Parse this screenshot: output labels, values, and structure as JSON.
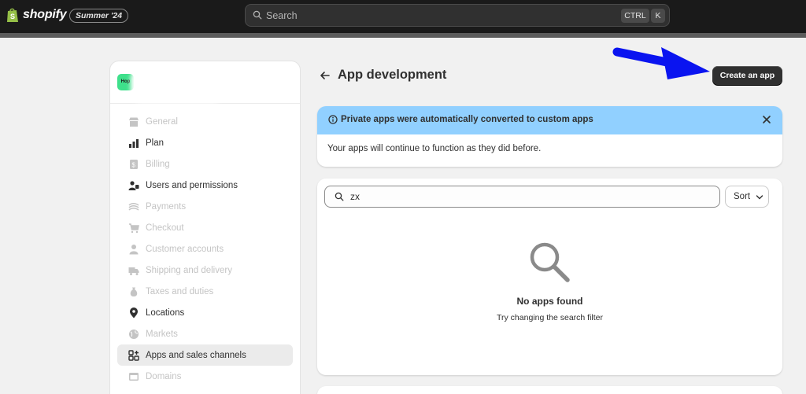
{
  "topbar": {
    "logo_text": "shopify",
    "edition_badge": "Summer '24",
    "search_placeholder": "Search",
    "shortcut_ctrl": "CTRL",
    "shortcut_k": "K"
  },
  "sidebar": {
    "store_avatar_text": "Hop",
    "items": [
      {
        "label": "General",
        "icon": "store-icon",
        "enabled": false
      },
      {
        "label": "Plan",
        "icon": "plan-chart-icon",
        "enabled": true
      },
      {
        "label": "Billing",
        "icon": "billing-icon",
        "enabled": false
      },
      {
        "label": "Users and permissions",
        "icon": "users-icon",
        "enabled": true
      },
      {
        "label": "Payments",
        "icon": "payments-icon",
        "enabled": false
      },
      {
        "label": "Checkout",
        "icon": "cart-icon",
        "enabled": false
      },
      {
        "label": "Customer accounts",
        "icon": "person-icon",
        "enabled": false
      },
      {
        "label": "Shipping and delivery",
        "icon": "truck-icon",
        "enabled": false
      },
      {
        "label": "Taxes and duties",
        "icon": "money-bag-icon",
        "enabled": false
      },
      {
        "label": "Locations",
        "icon": "location-pin-icon",
        "enabled": true
      },
      {
        "label": "Markets",
        "icon": "globe-icon",
        "enabled": false
      },
      {
        "label": "Apps and sales channels",
        "icon": "apps-icon",
        "enabled": true,
        "active": true
      },
      {
        "label": "Domains",
        "icon": "domain-icon",
        "enabled": false
      }
    ]
  },
  "main": {
    "title": "App development",
    "create_button": "Create an app",
    "banner": {
      "title": "Private apps were automatically converted to custom apps",
      "body": "Your apps will continue to function as they did before."
    },
    "filter": {
      "value": "zx",
      "sort_label": "Sort"
    },
    "empty_state": {
      "title": "No apps found",
      "subtitle": "Try changing the search filter"
    }
  },
  "colors": {
    "topbar": "#1a1a1a",
    "banner_info": "#91d0ff",
    "avatar": "#3ee08b",
    "annotation_arrow": "#0a14f0",
    "primary_button": "#303030"
  }
}
